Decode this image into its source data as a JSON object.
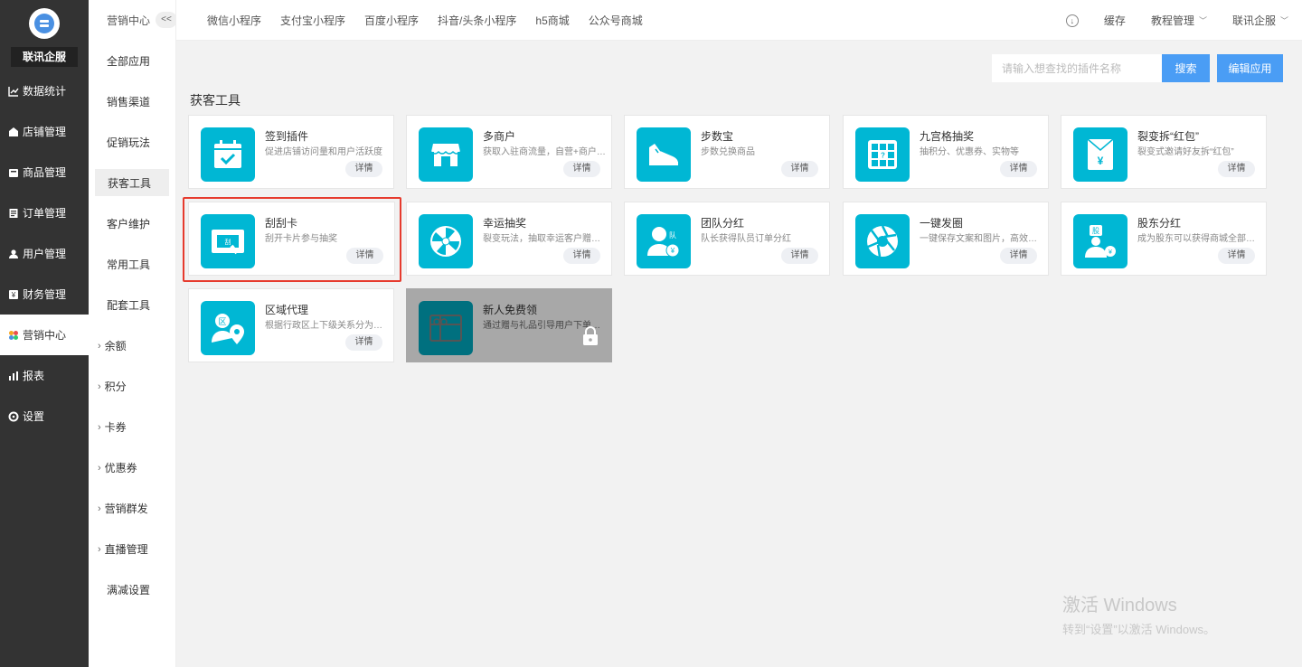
{
  "brand": {
    "name": "联讯企服"
  },
  "main_menu": [
    {
      "label": "数据统计",
      "icon": "chart-line-icon"
    },
    {
      "label": "店铺管理",
      "icon": "store-icon"
    },
    {
      "label": "商品管理",
      "icon": "goods-icon"
    },
    {
      "label": "订单管理",
      "icon": "order-icon"
    },
    {
      "label": "用户管理",
      "icon": "user-icon"
    },
    {
      "label": "财务管理",
      "icon": "finance-icon"
    },
    {
      "label": "营销中心",
      "icon": "marketing-icon",
      "active": true
    },
    {
      "label": "报表",
      "icon": "report-icon"
    },
    {
      "label": "设置",
      "icon": "gear-icon"
    }
  ],
  "sub_menu": {
    "header": "营销中心",
    "collapse": "<<",
    "items": [
      {
        "label": "全部应用"
      },
      {
        "label": "销售渠道"
      },
      {
        "label": "促销玩法"
      },
      {
        "label": "获客工具",
        "active": true
      },
      {
        "label": "客户维护"
      },
      {
        "label": "常用工具"
      },
      {
        "label": "配套工具"
      },
      {
        "label": "余额",
        "expandable": true
      },
      {
        "label": "积分",
        "expandable": true
      },
      {
        "label": "卡券",
        "expandable": true
      },
      {
        "label": "优惠券",
        "expandable": true
      },
      {
        "label": "营销群发",
        "expandable": true
      },
      {
        "label": "直播管理",
        "expandable": true
      },
      {
        "label": "满减设置"
      }
    ]
  },
  "top_tabs": [
    "微信小程序",
    "支付宝小程序",
    "百度小程序",
    "抖音/头条小程序",
    "h5商城",
    "公众号商城"
  ],
  "top_right": {
    "cache": "缓存",
    "tutorial": "教程管理",
    "account": "联讯企服"
  },
  "search": {
    "placeholder": "请输入想查找的插件名称",
    "button": "搜索"
  },
  "edit_button": "编辑应用",
  "section_title": "获客工具",
  "cards": [
    {
      "title": "签到插件",
      "desc": "促进店铺访问量和用户活跃度",
      "detail": "详情",
      "icon": "calendar-check-icon"
    },
    {
      "title": "多商户",
      "desc": "获取入驻商流量，自营+商户入...",
      "detail": "详情",
      "icon": "shop-icon"
    },
    {
      "title": "步数宝",
      "desc": "步数兑换商品",
      "detail": "详情",
      "icon": "sneaker-icon"
    },
    {
      "title": "九宫格抽奖",
      "desc": "抽积分、优惠券、实物等",
      "detail": "详情",
      "icon": "grid-icon"
    },
    {
      "title": "裂变拆“红包”",
      "desc": "裂变式邀请好友拆“红包”",
      "detail": "详情",
      "icon": "red-envelope-icon"
    },
    {
      "title": "刮刮卡",
      "desc": "刮开卡片参与抽奖",
      "detail": "详情",
      "icon": "scratch-card-icon"
    },
    {
      "title": "幸运抽奖",
      "desc": "裂变玩法，抽取幸运客户赠送...",
      "detail": "详情",
      "icon": "wheel-icon"
    },
    {
      "title": "团队分红",
      "desc": "队长获得队员订单分红",
      "detail": "详情",
      "icon": "team-icon"
    },
    {
      "title": "一键发圈",
      "desc": "一键保存文案和图片，高效发...",
      "detail": "详情",
      "icon": "aperture-icon"
    },
    {
      "title": "股东分红",
      "desc": "成为股东可以获得商城全部自...",
      "detail": "详情",
      "icon": "shareholder-icon"
    },
    {
      "title": "区域代理",
      "desc": "根据行政区上下级关系分为省...",
      "detail": "详情",
      "icon": "region-icon"
    },
    {
      "title": "新人免费领",
      "desc": "通过赠与礼品引导用户下单，...",
      "locked": true,
      "icon": "gift-icon"
    }
  ],
  "watermark": {
    "line1": "激活 Windows",
    "line2": "转到“设置”以激活 Windows。"
  }
}
